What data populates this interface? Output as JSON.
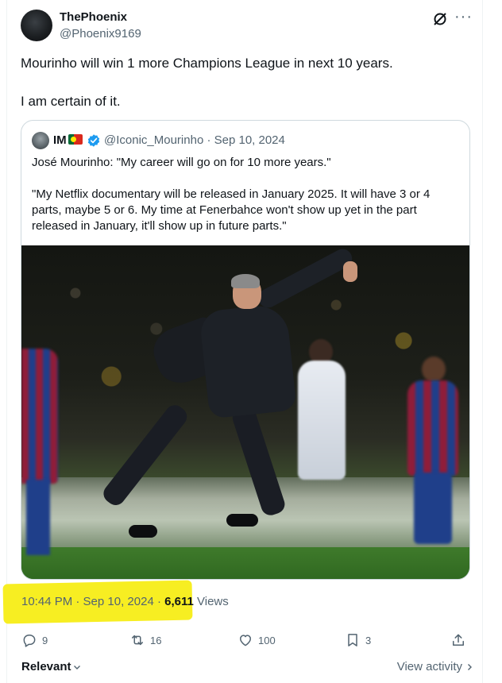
{
  "author": {
    "display_name": "ThePhoenix",
    "handle": "@Phoenix9169"
  },
  "tweet": {
    "paragraphs": [
      "Mourinho will win 1 more Champions League in next 10 years.",
      "I am certain of it."
    ]
  },
  "quoted": {
    "display_name": "IM",
    "handle_and_date": "@Iconic_Mourinho · Sep 10, 2024",
    "paragraphs": [
      "José Mourinho: \"My career will go on for 10 more years.\"",
      "\"My Netflix documentary will be released in January 2025. It will have 3 or 4 parts, maybe 5 or 6. My time at Fenerbahce won't show up yet in the part released in January, it'll show up in future parts.\""
    ]
  },
  "meta": {
    "timestamp": "10:44 PM · Sep 10, 2024 · ",
    "views_count": "6,611",
    "views_label": " Views"
  },
  "actions": {
    "replies": "9",
    "reposts": "16",
    "likes": "100",
    "bookmarks": "3"
  },
  "footer": {
    "sort_label": "Relevant",
    "view_activity": "View activity"
  },
  "colors": {
    "accent": "#1d9bf0",
    "highlight": "#f7ee22",
    "secondary_text": "#536471"
  }
}
